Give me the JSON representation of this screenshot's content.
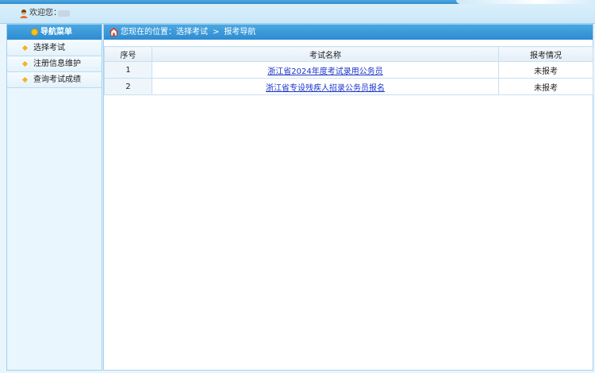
{
  "welcome": {
    "label": "欢迎您："
  },
  "sidebar": {
    "header": "导航菜单",
    "items": [
      {
        "label": "选择考试"
      },
      {
        "label": "注册信息维护"
      },
      {
        "label": "查询考试成绩"
      }
    ]
  },
  "breadcrumb": {
    "prefix": "您现在的位置：",
    "path": [
      "选择考试",
      "报考导航"
    ],
    "separator": ">"
  },
  "table": {
    "headers": [
      "序号",
      "考试名称",
      "报考情况"
    ],
    "rows": [
      {
        "index": "1",
        "name": "浙江省2024年度考试录用公务员",
        "status": "未报考"
      },
      {
        "index": "2",
        "name": "浙江省专设残疾人招录公务员报名",
        "status": "未报考"
      }
    ]
  },
  "colors": {
    "accent": "#2e8bd1",
    "link": "#1a33c9",
    "bullet": "#f2b51c"
  }
}
